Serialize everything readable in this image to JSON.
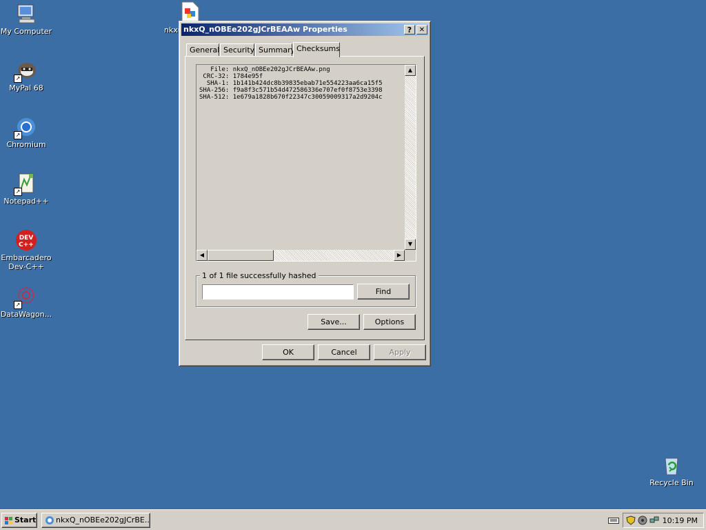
{
  "desktop": {
    "icons": [
      {
        "label": "My Computer",
        "icon": "my-computer-icon"
      },
      {
        "label": "MyPal 68",
        "icon": "mypal-icon"
      },
      {
        "label": "Chromium",
        "icon": "chromium-icon"
      },
      {
        "label": "Notepad++",
        "icon": "notepad-plus-plus-icon"
      },
      {
        "label": "Embarcadero Dev-C++",
        "icon": "devcpp-icon"
      },
      {
        "label": "DataWagon...",
        "icon": "datawagon-icon"
      },
      {
        "label": "Recycle Bin",
        "icon": "recycle-bin-icon"
      },
      {
        "label": "nkx0",
        "icon": "png-file-icon"
      }
    ]
  },
  "dialog": {
    "title": "nkxQ_nOBEe202gJCrBEAAw Properties",
    "help_label": "?",
    "close_label": "✕",
    "tabs": [
      {
        "label": "General"
      },
      {
        "label": "Security"
      },
      {
        "label": "Summary"
      },
      {
        "label": "Checksums",
        "active": true
      }
    ],
    "checksums": {
      "lines": [
        "   File: nkxQ_nOBEe202gJCrBEAAw.png",
        " CRC-32: 1784e95f",
        "  SHA-1: 1b141b424dc8b39835ebab71e554223aa6ca15f5",
        "SHA-256: f9a8f3c571b54d472586336e707ef0f8753e3398",
        "SHA-512: 1e679a1828b670f22347c30059009317a2d9204c"
      ]
    },
    "find_group": {
      "label": "1 of 1 file successfully hashed",
      "input_value": "",
      "find_label": "Find"
    },
    "save_label": "Save...",
    "options_label": "Options",
    "ok_label": "OK",
    "cancel_label": "Cancel",
    "apply_label": "Apply"
  },
  "taskbar": {
    "start_label": "Start",
    "task_label": "nkxQ_nOBEe202gJCrBE...",
    "clock": "10:19 PM"
  }
}
